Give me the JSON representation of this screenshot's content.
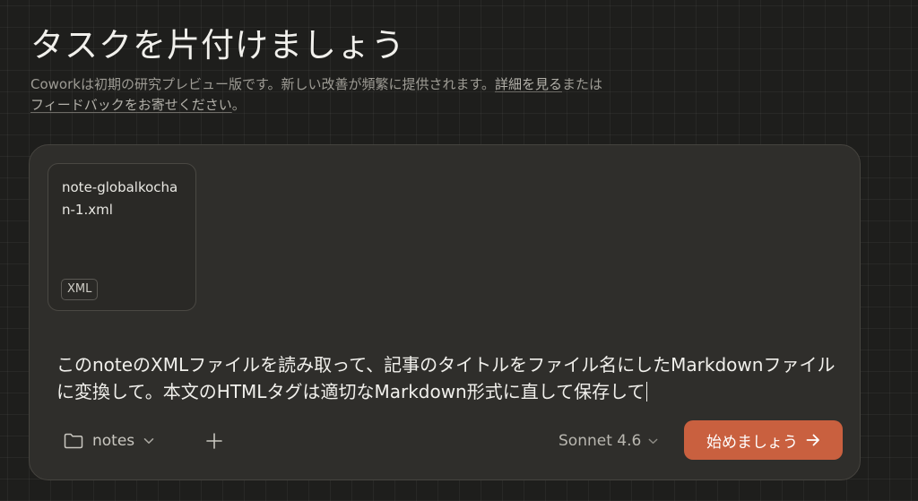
{
  "page": {
    "heading": "タスクを片付けましょう",
    "subtitle": {
      "text_before": "Coworkは初期の研究プレビュー版です。新しい改善が頻繁に提供されます。",
      "details_link": "詳細を見る",
      "text_middle": "または",
      "feedback_link": "フィードバックをお寄せください",
      "text_after": "。"
    }
  },
  "composer": {
    "attachment": {
      "name": "note-globalkochan-1.xml",
      "type_badge": "XML"
    },
    "prompt": "このnoteのXMLファイルを読み取って、記事のタイトルをファイル名にしたMarkdownファイルに変換して。本文のHTMLタグは適切なMarkdown形式に直して保存して",
    "toolbar": {
      "folder_icon": "folder-icon",
      "folder_label": "notes",
      "add_icon": "plus-icon",
      "model_label": "Sonnet 4.6",
      "start_label": "始めましょう",
      "start_icon": "arrow-right-icon"
    }
  },
  "colors": {
    "background": "#1e1e1c",
    "panel": "#2f2e2b",
    "accent": "#c9603f",
    "text": "#f1f0ec",
    "muted_text": "#9e9c95"
  }
}
